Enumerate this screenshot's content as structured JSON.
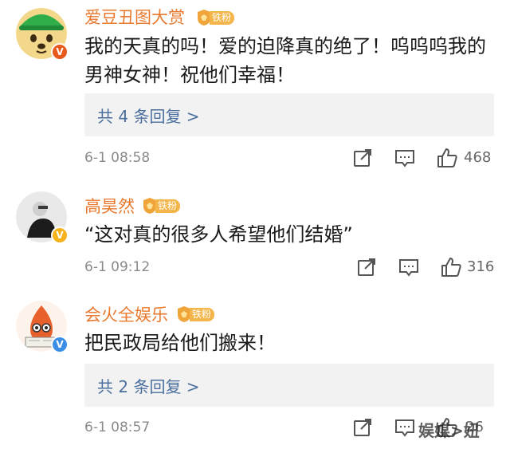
{
  "comments": [
    {
      "username": "爱豆丑图大赏",
      "fan_badge": "铁粉",
      "text": "我的天真的吗！爱的迫降真的绝了！呜呜呜我的男神女神！祝他们幸福！",
      "replies": "共 4 条回复 >",
      "timestamp": "6-1 08:58",
      "likes": "468",
      "verify_color": "#e85a1b"
    },
    {
      "username": "高昊然",
      "fan_badge": "铁粉",
      "text": "“这对真的很多人希望他们结婚”",
      "timestamp": "6-1 09:12",
      "likes": "316",
      "verify_color": "#f5b21b"
    },
    {
      "username": "会火全娱乐",
      "fan_badge": "铁粉",
      "text": "把民政局给他们搬来！",
      "replies": "共 2 条回复 >",
      "timestamp": "6-1 08:57",
      "likes": "26",
      "verify_color": "#3a8ee6"
    }
  ],
  "icons": {
    "share": "share-icon",
    "comment": "comment-icon",
    "like": "thumbs-up-icon"
  },
  "watermark": "娱媒>妞"
}
